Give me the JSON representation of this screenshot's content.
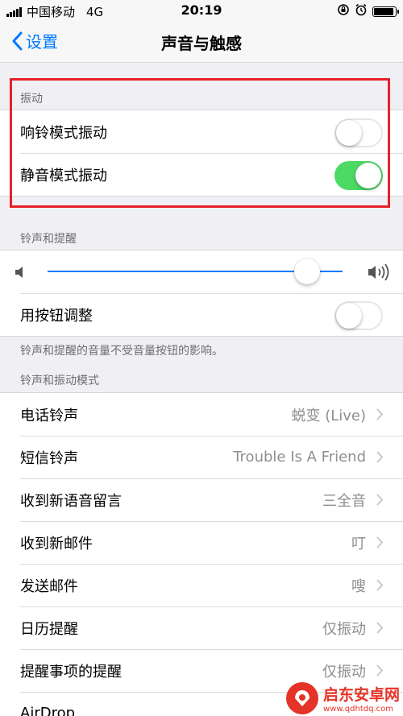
{
  "status_bar": {
    "carrier": "中国移动",
    "network": "4G",
    "time": "20:19"
  },
  "nav": {
    "back_label": "设置",
    "title": "声音与触感"
  },
  "vibration": {
    "header": "振动",
    "rows": [
      {
        "label": "响铃模式振动",
        "on": false
      },
      {
        "label": "静音模式振动",
        "on": true
      }
    ]
  },
  "ringer": {
    "header": "铃声和提醒",
    "volume_level": 0.88,
    "adjust_label": "用按钮调整",
    "adjust_on": false,
    "footer": "铃声和提醒的音量不受音量按钮的影响。"
  },
  "patterns": {
    "header": "铃声和振动模式",
    "rows": [
      {
        "label": "电话铃声",
        "value": "蜕变 (Live)"
      },
      {
        "label": "短信铃声",
        "value": "Trouble Is A Friend"
      },
      {
        "label": "收到新语音留言",
        "value": "三全音"
      },
      {
        "label": "收到新邮件",
        "value": "叮"
      },
      {
        "label": "发送邮件",
        "value": "嗖"
      },
      {
        "label": "日历提醒",
        "value": "仅振动"
      },
      {
        "label": "提醒事项的提醒",
        "value": "仅振动"
      },
      {
        "label": "AirDrop",
        "value": ""
      }
    ]
  },
  "watermark": {
    "name": "启东安卓网",
    "url": "www.qdhtdq.com"
  },
  "colors": {
    "accent": "#007aff",
    "toggle_on": "#4cd964",
    "highlight_box": "#e8212b"
  }
}
